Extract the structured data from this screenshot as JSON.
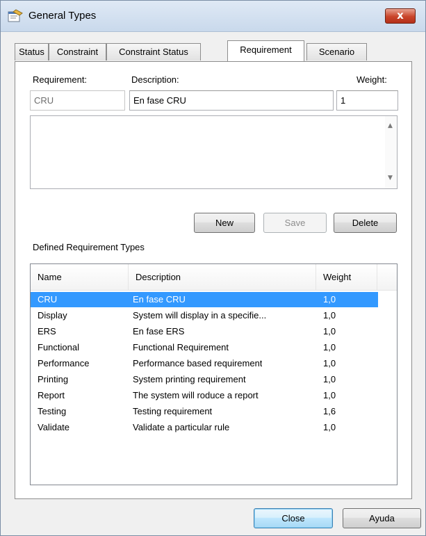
{
  "window": {
    "title": "General Types",
    "close_glyph": "x"
  },
  "tabs": [
    {
      "label": "Status"
    },
    {
      "label": "Constraint"
    },
    {
      "label": "Constraint Status"
    },
    {
      "label": "Requirement"
    },
    {
      "label": "Scenario"
    }
  ],
  "form": {
    "requirement_label": "Requirement:",
    "description_label": "Description:",
    "weight_label": "Weight:",
    "requirement_value": "CRU",
    "description_value": "En fase CRU",
    "weight_value": "1",
    "memo_value": ""
  },
  "actions": {
    "new": "New",
    "save": "Save",
    "delete": "Delete"
  },
  "list": {
    "caption": "Defined Requirement Types",
    "headers": [
      "Name",
      "Description",
      "Weight"
    ],
    "rows": [
      {
        "name": "CRU",
        "description": "En fase CRU",
        "weight": "1,0"
      },
      {
        "name": "Display",
        "description": "System will display in a specifie...",
        "weight": "1,0"
      },
      {
        "name": "ERS",
        "description": "En fase ERS",
        "weight": "1,0"
      },
      {
        "name": "Functional",
        "description": "Functional Requirement",
        "weight": "1,0"
      },
      {
        "name": "Performance",
        "description": "Performance based requirement",
        "weight": "1,0"
      },
      {
        "name": "Printing",
        "description": "System printing requirement",
        "weight": "1,0"
      },
      {
        "name": "Report",
        "description": "The system will roduce a report",
        "weight": "1,0"
      },
      {
        "name": "Testing",
        "description": "Testing requirement",
        "weight": "1,6"
      },
      {
        "name": "Validate",
        "description": "Validate a particular rule",
        "weight": "1,0"
      }
    ]
  },
  "footer": {
    "close": "Close",
    "help": "Ayuda"
  },
  "colors": {
    "selection": "#3399ff",
    "close_button": "#c9442a"
  }
}
